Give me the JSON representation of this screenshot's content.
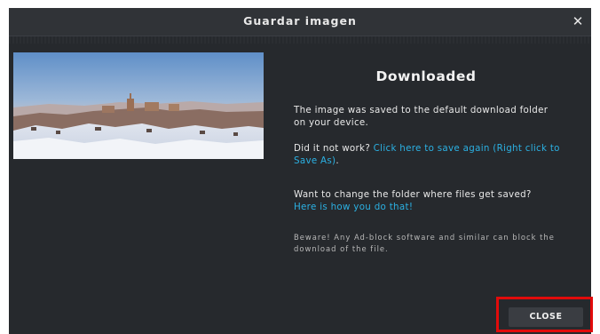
{
  "dialog": {
    "title": "Guardar imagen",
    "close_icon": "close-icon"
  },
  "content": {
    "heading": "Downloaded",
    "saved_text": "The image was saved to the default download folder on your device.",
    "retry_prefix": "Did it not work? ",
    "retry_link": "Click here to save again (Right click to Save As)",
    "retry_suffix": ".",
    "change_folder_text": "Want to change the folder where files get saved?",
    "change_folder_link": "Here is how you do that!",
    "warning_text": "Beware! Any Ad-block software and similar can block the download of the file."
  },
  "footer": {
    "close_label": "CLOSE"
  },
  "colors": {
    "dialog_bg": "#26292d",
    "link": "#2bb0e2",
    "highlight": "#e10b0b"
  }
}
